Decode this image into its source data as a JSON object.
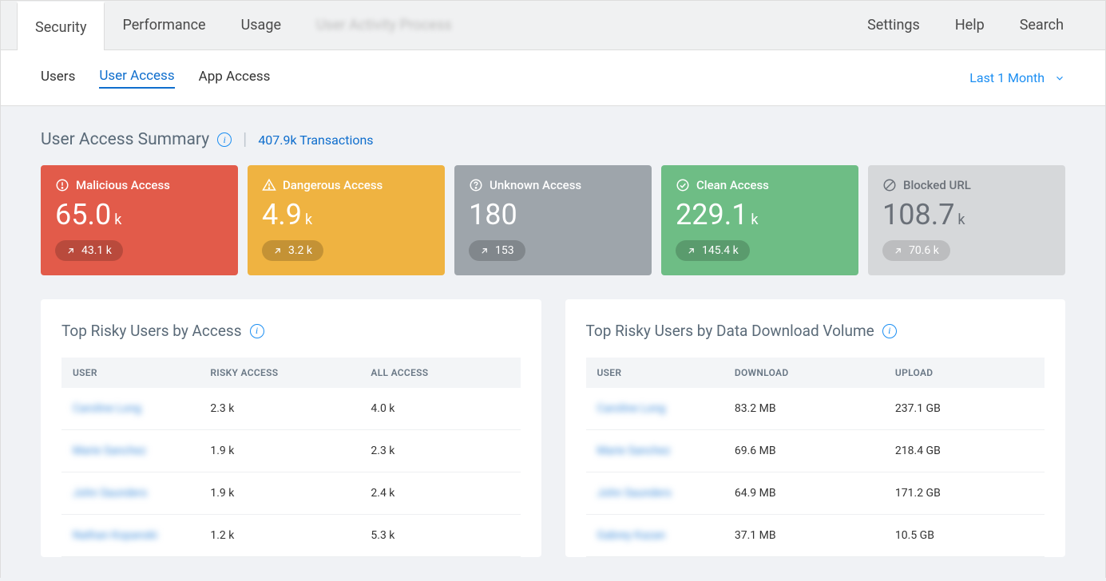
{
  "topnav": {
    "tabs": [
      {
        "id": "security",
        "label": "Security"
      },
      {
        "id": "performance",
        "label": "Performance"
      },
      {
        "id": "usage",
        "label": "Usage"
      }
    ],
    "blurred": "User Activity Process",
    "right": {
      "settings": "Settings",
      "help": "Help",
      "search": "Search"
    }
  },
  "subnav": {
    "tabs": [
      {
        "id": "users",
        "label": "Users"
      },
      {
        "id": "user-access",
        "label": "User Access"
      },
      {
        "id": "app-access",
        "label": "App Access"
      }
    ],
    "range": "Last 1 Month"
  },
  "summary": {
    "title": "User Access Summary",
    "transactions": "407.9k Transactions"
  },
  "stats": [
    {
      "id": "malicious",
      "label": "Malicious Access",
      "value": "65.0",
      "unit": "k",
      "pill": "43.1 k",
      "bg": "#e25b4a"
    },
    {
      "id": "dangerous",
      "label": "Dangerous Access",
      "value": "4.9",
      "unit": "k",
      "pill": "3.2 k",
      "bg": "#efb341"
    },
    {
      "id": "unknown",
      "label": "Unknown Access",
      "value": "180",
      "unit": "",
      "pill": "153",
      "bg": "#9ea5ab"
    },
    {
      "id": "clean",
      "label": "Clean Access",
      "value": "229.1",
      "unit": "k",
      "pill": "145.4 k",
      "bg": "#6ebd85"
    },
    {
      "id": "blocked",
      "label": "Blocked URL",
      "value": "108.7",
      "unit": "k",
      "pill": "70.6 k",
      "bg": "#d6d8da",
      "muted": true
    }
  ],
  "risky_access": {
    "title": "Top Risky Users by Access",
    "columns": {
      "user": "USER",
      "risky": "RISKY ACCESS",
      "all": "ALL ACCESS"
    },
    "rows": [
      {
        "user": "Caroline Long",
        "risky": "2.3 k",
        "all": "4.0 k"
      },
      {
        "user": "Marie Sanchez",
        "risky": "1.9 k",
        "all": "2.3 k"
      },
      {
        "user": "John Saunders",
        "risky": "1.9 k",
        "all": "2.4 k"
      },
      {
        "user": "Nathan Kopanski",
        "risky": "1.2 k",
        "all": "5.3 k"
      }
    ]
  },
  "risky_download": {
    "title": "Top Risky Users by Data Download Volume",
    "columns": {
      "user": "USER",
      "download": "DOWNLOAD",
      "upload": "UPLOAD"
    },
    "rows": [
      {
        "user": "Caroline Long",
        "download": "83.2 MB",
        "upload": "237.1 GB"
      },
      {
        "user": "Marie Sanchez",
        "download": "69.6 MB",
        "upload": "218.4 GB"
      },
      {
        "user": "John Saunders",
        "download": "64.9 MB",
        "upload": "171.2 GB"
      },
      {
        "user": "Gabrey Kazan",
        "download": "37.1 MB",
        "upload": "10.5 GB"
      }
    ]
  }
}
